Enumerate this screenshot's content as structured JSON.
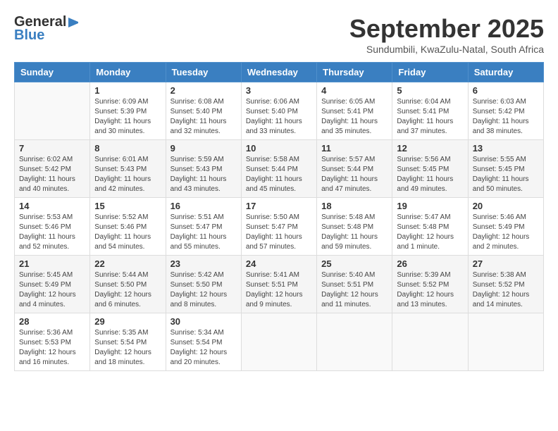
{
  "header": {
    "logo_general": "General",
    "logo_blue": "Blue",
    "month": "September 2025",
    "location": "Sundumbili, KwaZulu-Natal, South Africa"
  },
  "weekdays": [
    "Sunday",
    "Monday",
    "Tuesday",
    "Wednesday",
    "Thursday",
    "Friday",
    "Saturday"
  ],
  "weeks": [
    [
      {
        "day": "",
        "info": ""
      },
      {
        "day": "1",
        "info": "Sunrise: 6:09 AM\nSunset: 5:39 PM\nDaylight: 11 hours\nand 30 minutes."
      },
      {
        "day": "2",
        "info": "Sunrise: 6:08 AM\nSunset: 5:40 PM\nDaylight: 11 hours\nand 32 minutes."
      },
      {
        "day": "3",
        "info": "Sunrise: 6:06 AM\nSunset: 5:40 PM\nDaylight: 11 hours\nand 33 minutes."
      },
      {
        "day": "4",
        "info": "Sunrise: 6:05 AM\nSunset: 5:41 PM\nDaylight: 11 hours\nand 35 minutes."
      },
      {
        "day": "5",
        "info": "Sunrise: 6:04 AM\nSunset: 5:41 PM\nDaylight: 11 hours\nand 37 minutes."
      },
      {
        "day": "6",
        "info": "Sunrise: 6:03 AM\nSunset: 5:42 PM\nDaylight: 11 hours\nand 38 minutes."
      }
    ],
    [
      {
        "day": "7",
        "info": "Sunrise: 6:02 AM\nSunset: 5:42 PM\nDaylight: 11 hours\nand 40 minutes."
      },
      {
        "day": "8",
        "info": "Sunrise: 6:01 AM\nSunset: 5:43 PM\nDaylight: 11 hours\nand 42 minutes."
      },
      {
        "day": "9",
        "info": "Sunrise: 5:59 AM\nSunset: 5:43 PM\nDaylight: 11 hours\nand 43 minutes."
      },
      {
        "day": "10",
        "info": "Sunrise: 5:58 AM\nSunset: 5:44 PM\nDaylight: 11 hours\nand 45 minutes."
      },
      {
        "day": "11",
        "info": "Sunrise: 5:57 AM\nSunset: 5:44 PM\nDaylight: 11 hours\nand 47 minutes."
      },
      {
        "day": "12",
        "info": "Sunrise: 5:56 AM\nSunset: 5:45 PM\nDaylight: 11 hours\nand 49 minutes."
      },
      {
        "day": "13",
        "info": "Sunrise: 5:55 AM\nSunset: 5:45 PM\nDaylight: 11 hours\nand 50 minutes."
      }
    ],
    [
      {
        "day": "14",
        "info": "Sunrise: 5:53 AM\nSunset: 5:46 PM\nDaylight: 11 hours\nand 52 minutes."
      },
      {
        "day": "15",
        "info": "Sunrise: 5:52 AM\nSunset: 5:46 PM\nDaylight: 11 hours\nand 54 minutes."
      },
      {
        "day": "16",
        "info": "Sunrise: 5:51 AM\nSunset: 5:47 PM\nDaylight: 11 hours\nand 55 minutes."
      },
      {
        "day": "17",
        "info": "Sunrise: 5:50 AM\nSunset: 5:47 PM\nDaylight: 11 hours\nand 57 minutes."
      },
      {
        "day": "18",
        "info": "Sunrise: 5:48 AM\nSunset: 5:48 PM\nDaylight: 11 hours\nand 59 minutes."
      },
      {
        "day": "19",
        "info": "Sunrise: 5:47 AM\nSunset: 5:48 PM\nDaylight: 12 hours\nand 1 minute."
      },
      {
        "day": "20",
        "info": "Sunrise: 5:46 AM\nSunset: 5:49 PM\nDaylight: 12 hours\nand 2 minutes."
      }
    ],
    [
      {
        "day": "21",
        "info": "Sunrise: 5:45 AM\nSunset: 5:49 PM\nDaylight: 12 hours\nand 4 minutes."
      },
      {
        "day": "22",
        "info": "Sunrise: 5:44 AM\nSunset: 5:50 PM\nDaylight: 12 hours\nand 6 minutes."
      },
      {
        "day": "23",
        "info": "Sunrise: 5:42 AM\nSunset: 5:50 PM\nDaylight: 12 hours\nand 8 minutes."
      },
      {
        "day": "24",
        "info": "Sunrise: 5:41 AM\nSunset: 5:51 PM\nDaylight: 12 hours\nand 9 minutes."
      },
      {
        "day": "25",
        "info": "Sunrise: 5:40 AM\nSunset: 5:51 PM\nDaylight: 12 hours\nand 11 minutes."
      },
      {
        "day": "26",
        "info": "Sunrise: 5:39 AM\nSunset: 5:52 PM\nDaylight: 12 hours\nand 13 minutes."
      },
      {
        "day": "27",
        "info": "Sunrise: 5:38 AM\nSunset: 5:52 PM\nDaylight: 12 hours\nand 14 minutes."
      }
    ],
    [
      {
        "day": "28",
        "info": "Sunrise: 5:36 AM\nSunset: 5:53 PM\nDaylight: 12 hours\nand 16 minutes."
      },
      {
        "day": "29",
        "info": "Sunrise: 5:35 AM\nSunset: 5:54 PM\nDaylight: 12 hours\nand 18 minutes."
      },
      {
        "day": "30",
        "info": "Sunrise: 5:34 AM\nSunset: 5:54 PM\nDaylight: 12 hours\nand 20 minutes."
      },
      {
        "day": "",
        "info": ""
      },
      {
        "day": "",
        "info": ""
      },
      {
        "day": "",
        "info": ""
      },
      {
        "day": "",
        "info": ""
      }
    ]
  ]
}
